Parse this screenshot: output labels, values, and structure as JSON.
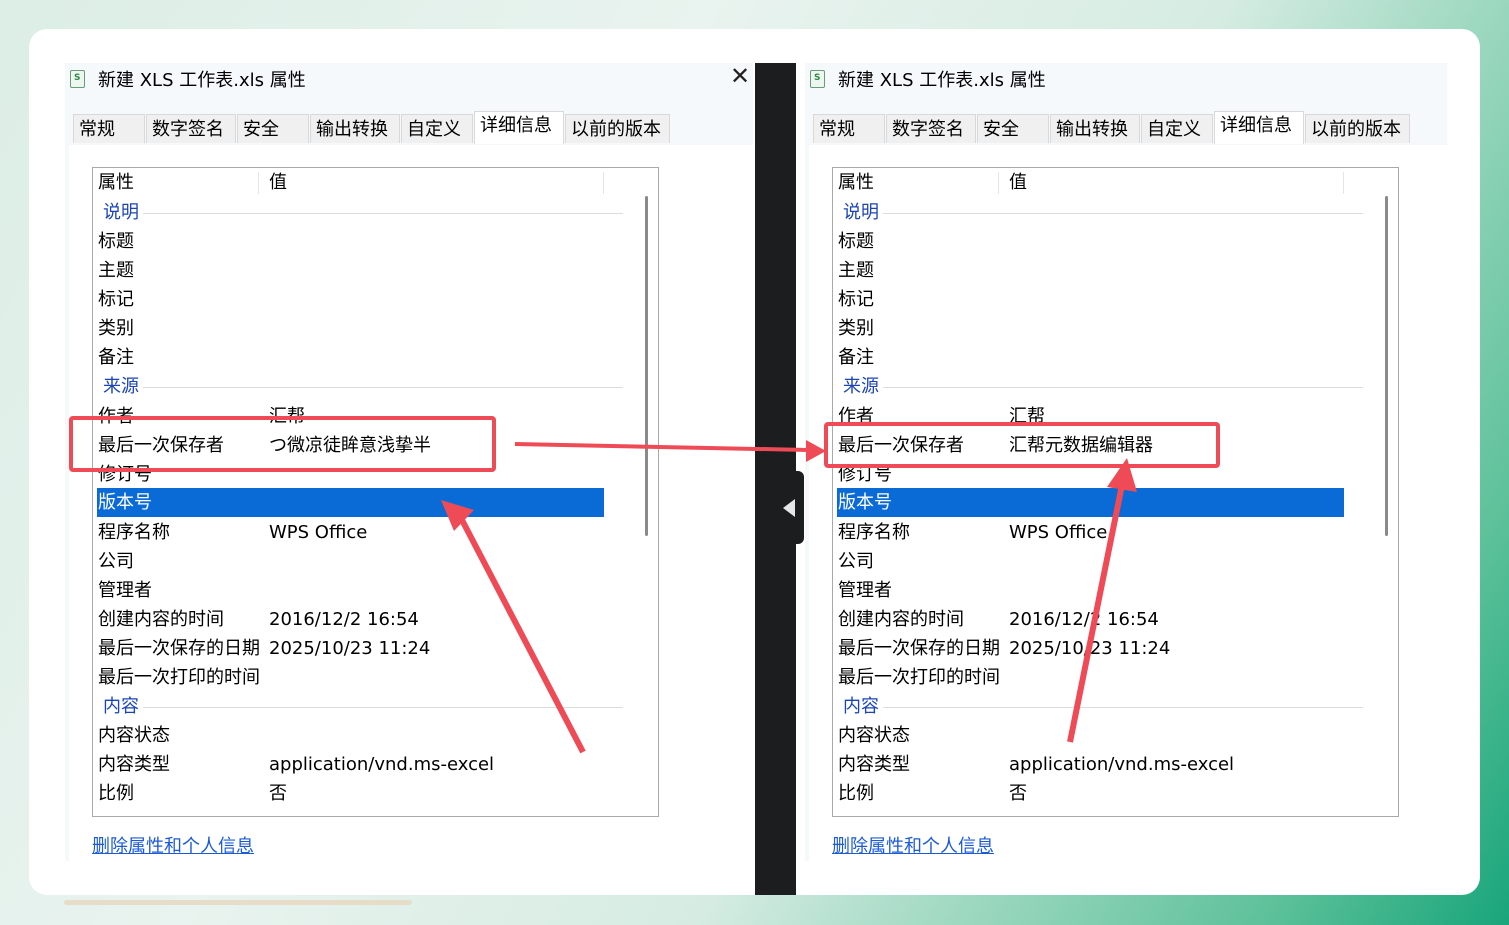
{
  "dialog": {
    "title": "新建 XLS 工作表.xls 属性",
    "close_glyph": "✕",
    "tabs": [
      "常规",
      "数字签名",
      "安全",
      "输出转换",
      "自定义",
      "详细信息",
      "以前的版本"
    ],
    "active_tab": "详细信息",
    "columns": {
      "property": "属性",
      "value": "值"
    },
    "groups": {
      "description": "说明",
      "origin": "来源",
      "content": "内容"
    },
    "labels": {
      "title": "标题",
      "subject": "主题",
      "tags": "标记",
      "category": "类别",
      "comments": "备注",
      "author": "作者",
      "last_saved_by": "最后一次保存者",
      "revision": "修订号",
      "version": "版本号",
      "program": "程序名称",
      "company": "公司",
      "manager": "管理者",
      "created": "创建内容的时间",
      "last_saved_date": "最后一次保存的日期",
      "last_printed": "最后一次打印的时间",
      "content_status": "内容状态",
      "content_type": "内容类型",
      "scale": "比例"
    },
    "delete_link": "删除属性和个人信息"
  },
  "left_window": {
    "author": "汇帮",
    "last_saved_by": "つ微凉徒眸意浅挚半",
    "program": "WPS Office",
    "created": "2016/12/2 16:54",
    "last_saved_date": "2025/10/23 11:24",
    "content_type": "application/vnd.ms-excel",
    "scale": "否"
  },
  "right_window": {
    "author": "汇帮",
    "last_saved_by": "汇帮元数据编辑器",
    "program": "WPS Office",
    "created": "2016/12/2 16:54",
    "last_saved_date": "2025/10/23 11:24",
    "content_type": "application/vnd.ms-excel",
    "scale": "否"
  },
  "colors": {
    "highlight_box": "#ef4b57",
    "selection": "#0a6ad6",
    "group_header": "#1a44b8",
    "link": "#1c5bd8"
  }
}
